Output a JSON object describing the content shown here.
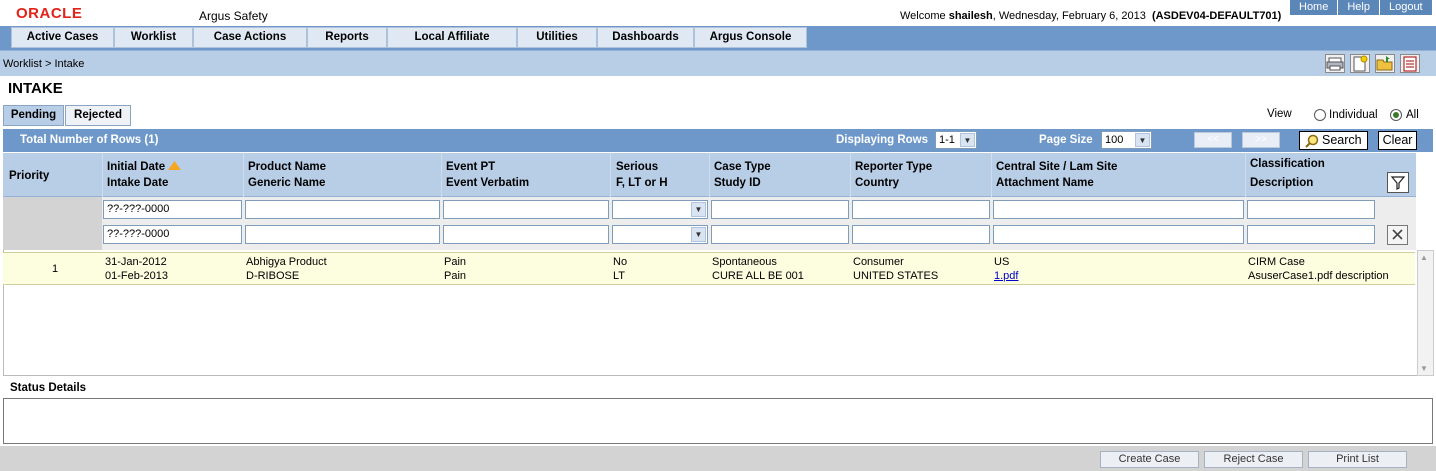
{
  "header": {
    "logo": "ORACLE",
    "app_name": "Argus Safety",
    "welcome_prefix": "Welcome",
    "user": "shailesh",
    "date": ", Wednesday, February 6, 2013",
    "environment": "(ASDEV04-DEFAULT701)",
    "links": [
      "Home",
      "Help",
      "Logout"
    ]
  },
  "nav": {
    "items": [
      "Active Cases",
      "Worklist",
      "Case Actions",
      "Reports",
      "Local Affiliate",
      "Utilities",
      "Dashboards",
      "Argus Console"
    ]
  },
  "breadcrumb": "Worklist > Intake",
  "page_title": "INTAKE",
  "tabs": [
    "Pending",
    "Rejected"
  ],
  "view": {
    "label": "View",
    "options": [
      "Individual",
      "All"
    ],
    "selected": "All"
  },
  "table_bar": {
    "total_rows": "Total Number of Rows (1)",
    "displaying_label": "Displaying Rows",
    "displaying_value": "1-1",
    "page_size_label": "Page Size",
    "page_size_value": "100",
    "prev_label": "<<",
    "next_label": ">>",
    "search_label": "Search",
    "clear_label": "Clear"
  },
  "columns": {
    "priority": "Priority",
    "initial_date": "Initial Date",
    "intake_date": "Intake Date",
    "product_name": "Product Name",
    "generic_name": "Generic Name",
    "event_pt": "Event PT",
    "event_verbatim": "Event Verbatim",
    "serious": "Serious",
    "flt": "F, LT or H",
    "case_type": "Case Type",
    "study_id": "Study ID",
    "reporter_type": "Reporter Type",
    "country": "Country",
    "central_site": "Central Site / Lam Site",
    "attachment_name": "Attachment Name",
    "classification": "Classification",
    "description": "Description"
  },
  "filters": {
    "date_placeholder_1": "??-???-0000",
    "date_placeholder_2": "??-???-0000"
  },
  "rows": [
    {
      "priority": "1",
      "initial_date": "31-Jan-2012",
      "intake_date": "01-Feb-2013",
      "product_name": "Abhigya Product",
      "generic_name": "D-RIBOSE",
      "event_pt": "Pain",
      "event_verbatim": "Pain",
      "serious": "No",
      "flt": "LT",
      "case_type": "Spontaneous",
      "study_id": "CURE ALL BE 001",
      "reporter_type": "Consumer",
      "country": "UNITED STATES",
      "central_site": "US",
      "attachment_name": "1.pdf",
      "classification": "CIRM Case",
      "description": "AsuserCase1.pdf description"
    }
  ],
  "status_details_label": "Status Details",
  "footer_buttons": [
    "Create Case",
    "Reject Case",
    "Print List"
  ],
  "colors": {
    "nav_blue": "#6d98c9",
    "light_blue": "#b8cde6",
    "row_highlight": "#fdfde0",
    "oracle_red": "#e2231a"
  }
}
